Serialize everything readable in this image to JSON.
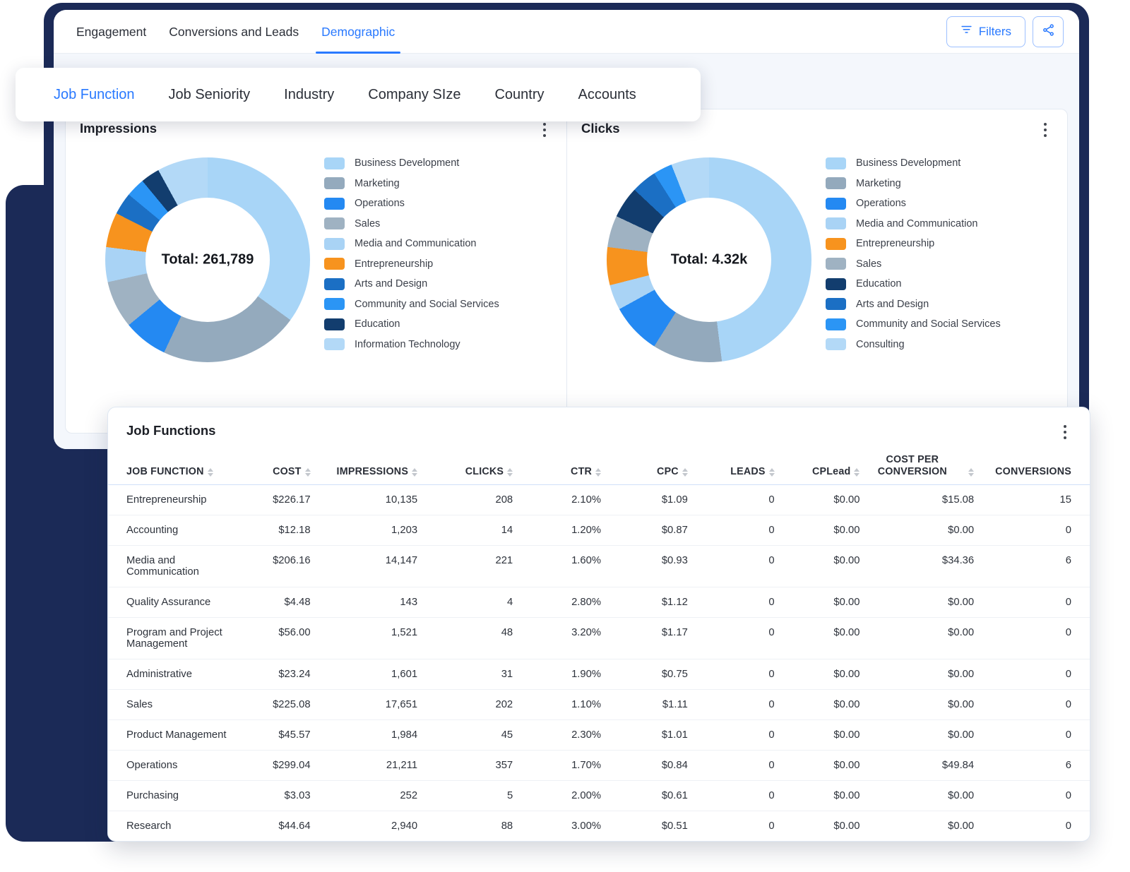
{
  "top_tabs": [
    {
      "label": "Engagement",
      "active": false
    },
    {
      "label": "Conversions and Leads",
      "active": false
    },
    {
      "label": "Demographic",
      "active": true
    }
  ],
  "toolbar": {
    "filters_label": "Filters",
    "filter_icon": "funnel-icon",
    "share_icon": "share-icon",
    "accent": "#2979ff"
  },
  "subnav": [
    {
      "label": "Job Function",
      "active": true
    },
    {
      "label": "Job Seniority",
      "active": false
    },
    {
      "label": "Industry",
      "active": false
    },
    {
      "label": "Company SIze",
      "active": false
    },
    {
      "label": "Country",
      "active": false
    },
    {
      "label": "Accounts",
      "active": false
    }
  ],
  "cards": {
    "impressions": {
      "title": "Impressions",
      "menu_icon": "kebab-menu-icon"
    },
    "clicks": {
      "title": "Clicks",
      "menu_icon": "kebab-menu-icon"
    }
  },
  "chart_data": [
    {
      "type": "pie",
      "title": "Impressions",
      "center_label": "Total: 261,789",
      "total": 261789,
      "legend_position": "right",
      "categories": [
        "Business Development",
        "Marketing",
        "Operations",
        "Sales",
        "Media and Communication",
        "Entrepreneurship",
        "Arts and Design",
        "Community and Social Services",
        "Education",
        "Information Technology"
      ],
      "values": [
        35,
        22,
        7,
        7.5,
        5.5,
        5.5,
        3.5,
        3,
        3,
        8
      ],
      "colors": [
        "#a8d5f7",
        "#94aabd",
        "#2489f2",
        "#9fb2c2",
        "#a9d3f5",
        "#f7931e",
        "#1b6fc4",
        "#2b95f5",
        "#123d6e",
        "#b3d9f7"
      ]
    },
    {
      "type": "pie",
      "title": "Clicks",
      "center_label": "Total: 4.32k",
      "total": 4320,
      "legend_position": "right",
      "categories": [
        "Business Development",
        "Marketing",
        "Operations",
        "Media and Communication",
        "Entrepreneurship",
        "Sales",
        "Education",
        "Arts and Design",
        "Community and Social Services",
        "Consulting"
      ],
      "values": [
        48,
        11,
        8,
        4,
        6,
        5,
        5,
        4,
        3,
        6
      ],
      "colors": [
        "#a8d5f7",
        "#93a9bc",
        "#2489f2",
        "#a9d3f5",
        "#f7931e",
        "#9fb2c2",
        "#123d6e",
        "#1b6fc4",
        "#2b95f5",
        "#b3d9f7"
      ]
    }
  ],
  "table": {
    "title": "Job Functions",
    "menu_icon": "kebab-menu-icon",
    "columns": [
      {
        "label": "JOB FUNCTION",
        "align": "left",
        "sortable": true
      },
      {
        "label": "COST",
        "align": "right",
        "sortable": true
      },
      {
        "label": "IMPRESSIONS",
        "align": "right",
        "sortable": true
      },
      {
        "label": "CLICKS",
        "align": "right",
        "sortable": true
      },
      {
        "label": "CTR",
        "align": "right",
        "sortable": true
      },
      {
        "label": "CPC",
        "align": "right",
        "sortable": true
      },
      {
        "label": "LEADS",
        "align": "right",
        "sortable": true
      },
      {
        "label": "CPLead",
        "align": "right",
        "sortable": true
      },
      {
        "label": "COST PER CONVERSION",
        "align": "right",
        "sortable": true
      },
      {
        "label": "CONVERSIONS",
        "align": "right",
        "sortable": false
      }
    ],
    "rows": [
      {
        "job_function": "Entrepreneurship",
        "cost": "$226.17",
        "impressions": "10,135",
        "clicks": "208",
        "ctr": "2.10%",
        "cpc": "$1.09",
        "leads": "0",
        "cplead": "$0.00",
        "cost_per_conversion": "$15.08",
        "conversions": "15"
      },
      {
        "job_function": "Accounting",
        "cost": "$12.18",
        "impressions": "1,203",
        "clicks": "14",
        "ctr": "1.20%",
        "cpc": "$0.87",
        "leads": "0",
        "cplead": "$0.00",
        "cost_per_conversion": "$0.00",
        "conversions": "0"
      },
      {
        "job_function": "Media and Communication",
        "cost": "$206.16",
        "impressions": "14,147",
        "clicks": "221",
        "ctr": "1.60%",
        "cpc": "$0.93",
        "leads": "0",
        "cplead": "$0.00",
        "cost_per_conversion": "$34.36",
        "conversions": "6"
      },
      {
        "job_function": "Quality Assurance",
        "cost": "$4.48",
        "impressions": "143",
        "clicks": "4",
        "ctr": "2.80%",
        "cpc": "$1.12",
        "leads": "0",
        "cplead": "$0.00",
        "cost_per_conversion": "$0.00",
        "conversions": "0"
      },
      {
        "job_function": "Program and Project Management",
        "cost": "$56.00",
        "impressions": "1,521",
        "clicks": "48",
        "ctr": "3.20%",
        "cpc": "$1.17",
        "leads": "0",
        "cplead": "$0.00",
        "cost_per_conversion": "$0.00",
        "conversions": "0"
      },
      {
        "job_function": "Administrative",
        "cost": "$23.24",
        "impressions": "1,601",
        "clicks": "31",
        "ctr": "1.90%",
        "cpc": "$0.75",
        "leads": "0",
        "cplead": "$0.00",
        "cost_per_conversion": "$0.00",
        "conversions": "0"
      },
      {
        "job_function": "Sales",
        "cost": "$225.08",
        "impressions": "17,651",
        "clicks": "202",
        "ctr": "1.10%",
        "cpc": "$1.11",
        "leads": "0",
        "cplead": "$0.00",
        "cost_per_conversion": "$0.00",
        "conversions": "0"
      },
      {
        "job_function": "Product Management",
        "cost": "$45.57",
        "impressions": "1,984",
        "clicks": "45",
        "ctr": "2.30%",
        "cpc": "$1.01",
        "leads": "0",
        "cplead": "$0.00",
        "cost_per_conversion": "$0.00",
        "conversions": "0"
      },
      {
        "job_function": "Operations",
        "cost": "$299.04",
        "impressions": "21,211",
        "clicks": "357",
        "ctr": "1.70%",
        "cpc": "$0.84",
        "leads": "0",
        "cplead": "$0.00",
        "cost_per_conversion": "$49.84",
        "conversions": "6"
      },
      {
        "job_function": "Purchasing",
        "cost": "$3.03",
        "impressions": "252",
        "clicks": "5",
        "ctr": "2.00%",
        "cpc": "$0.61",
        "leads": "0",
        "cplead": "$0.00",
        "cost_per_conversion": "$0.00",
        "conversions": "0"
      },
      {
        "job_function": "Research",
        "cost": "$44.64",
        "impressions": "2,940",
        "clicks": "88",
        "ctr": "3.00%",
        "cpc": "$0.51",
        "leads": "0",
        "cplead": "$0.00",
        "cost_per_conversion": "$0.00",
        "conversions": "0"
      }
    ]
  }
}
